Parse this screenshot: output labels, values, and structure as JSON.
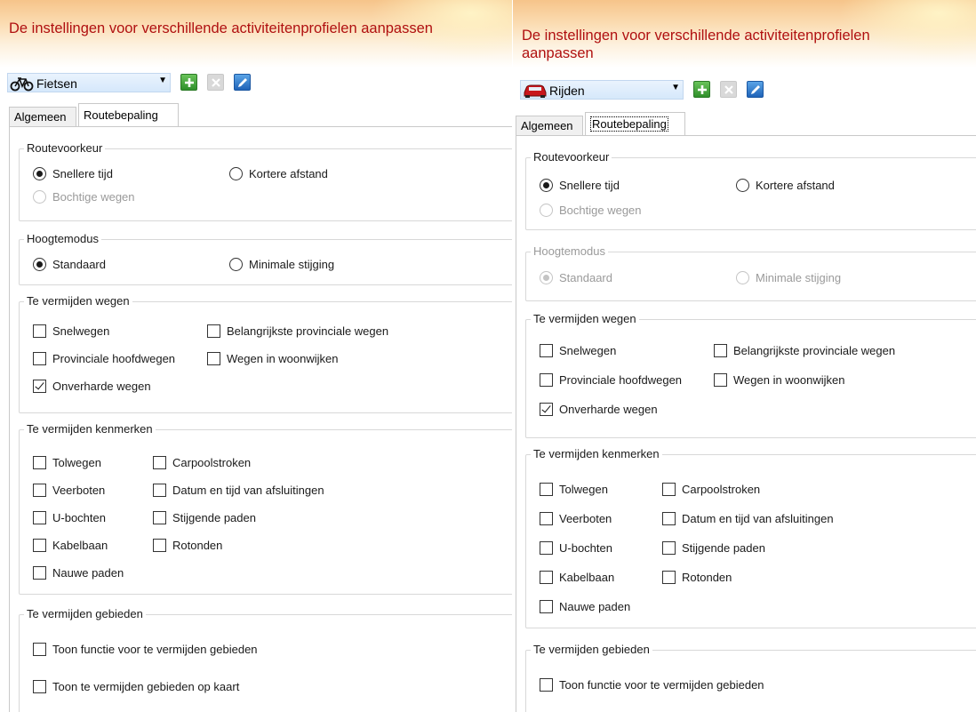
{
  "left": {
    "banner_title": "De instellingen voor verschillende activiteitenprofielen aanpassen",
    "profile": {
      "selected": "Fietsen",
      "icon": "bicycle-icon"
    },
    "tabs": [
      "Algemeen",
      "Routebepaling"
    ],
    "routevoorkeur": {
      "legend": "Routevoorkeur",
      "options": [
        {
          "label": "Snellere tijd",
          "checked": true,
          "enabled": true
        },
        {
          "label": "Kortere afstand",
          "checked": false,
          "enabled": true
        },
        {
          "label": "Bochtige wegen",
          "checked": false,
          "enabled": false
        }
      ]
    },
    "hoogtemodus": {
      "legend": "Hoogtemodus",
      "enabled": true,
      "options": [
        {
          "label": "Standaard",
          "checked": true
        },
        {
          "label": "Minimale stijging",
          "checked": false
        }
      ]
    },
    "wegen": {
      "legend": "Te vermijden wegen",
      "items": [
        {
          "label": "Snelwegen",
          "checked": false
        },
        {
          "label": "Belangrijkste provinciale wegen",
          "checked": false
        },
        {
          "label": "Provinciale hoofdwegen",
          "checked": false
        },
        {
          "label": "Wegen in woonwijken",
          "checked": false
        },
        {
          "label": "Onverharde wegen",
          "checked": true
        }
      ]
    },
    "kenmerken": {
      "legend": "Te vermijden kenmerken",
      "items": [
        {
          "label": "Tolwegen",
          "checked": false
        },
        {
          "label": "Carpoolstroken",
          "checked": false
        },
        {
          "label": "Veerboten",
          "checked": false
        },
        {
          "label": "Datum en tijd van afsluitingen",
          "checked": false
        },
        {
          "label": "U-bochten",
          "checked": false
        },
        {
          "label": "Stijgende paden",
          "checked": false
        },
        {
          "label": "Kabelbaan",
          "checked": false
        },
        {
          "label": "Rotonden",
          "checked": false
        },
        {
          "label": "Nauwe paden",
          "checked": false
        }
      ]
    },
    "gebieden": {
      "legend": "Te vermijden gebieden",
      "items": [
        {
          "label": "Toon functie voor te vermijden gebieden",
          "checked": false
        },
        {
          "label": "Toon te vermijden gebieden op kaart",
          "checked": false
        }
      ]
    }
  },
  "right": {
    "banner_title": "De instellingen voor verschillende activiteitenprofielen aanpassen",
    "profile": {
      "selected": "Rijden",
      "icon": "car-icon"
    },
    "tabs": [
      "Algemeen",
      "Routebepaling"
    ],
    "routevoorkeur": {
      "legend": "Routevoorkeur",
      "options": [
        {
          "label": "Snellere tijd",
          "checked": true,
          "enabled": true
        },
        {
          "label": "Kortere afstand",
          "checked": false,
          "enabled": true
        },
        {
          "label": "Bochtige wegen",
          "checked": false,
          "enabled": false
        }
      ]
    },
    "hoogtemodus": {
      "legend": "Hoogtemodus",
      "enabled": false,
      "options": [
        {
          "label": "Standaard",
          "checked": true
        },
        {
          "label": "Minimale stijging",
          "checked": false
        }
      ]
    },
    "wegen": {
      "legend": "Te vermijden wegen",
      "items": [
        {
          "label": "Snelwegen",
          "checked": false
        },
        {
          "label": "Belangrijkste provinciale wegen",
          "checked": false
        },
        {
          "label": "Provinciale hoofdwegen",
          "checked": false
        },
        {
          "label": "Wegen in woonwijken",
          "checked": false
        },
        {
          "label": "Onverharde wegen",
          "checked": true
        }
      ]
    },
    "kenmerken": {
      "legend": "Te vermijden kenmerken",
      "items": [
        {
          "label": "Tolwegen",
          "checked": false
        },
        {
          "label": "Carpoolstroken",
          "checked": false
        },
        {
          "label": "Veerboten",
          "checked": false
        },
        {
          "label": "Datum en tijd van afsluitingen",
          "checked": false
        },
        {
          "label": "U-bochten",
          "checked": false
        },
        {
          "label": "Stijgende paden",
          "checked": false
        },
        {
          "label": "Kabelbaan",
          "checked": false
        },
        {
          "label": "Rotonden",
          "checked": false
        },
        {
          "label": "Nauwe paden",
          "checked": false
        }
      ]
    },
    "gebieden": {
      "legend": "Te vermijden gebieden",
      "items": [
        {
          "label": "Toon functie voor te vermijden gebieden",
          "checked": false
        }
      ]
    }
  },
  "colors": {
    "title": "#b01010",
    "disabled_text": "#9a9a9a",
    "add_button": "#3fa535",
    "edit_button": "#2a6fc4"
  }
}
